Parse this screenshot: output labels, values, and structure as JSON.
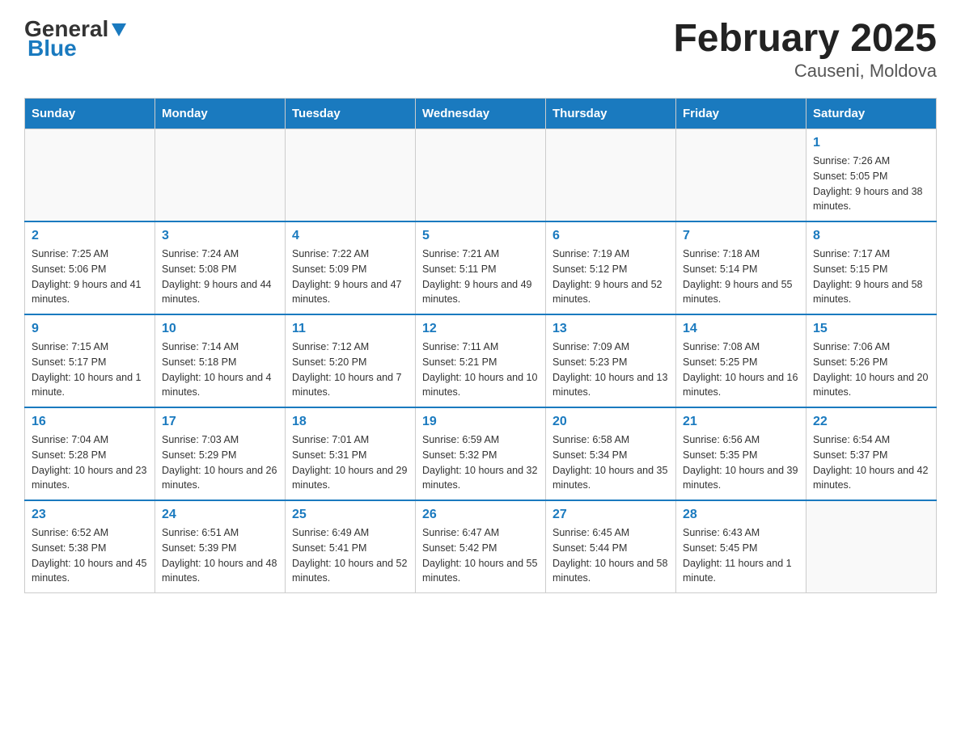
{
  "logo": {
    "general": "General",
    "blue": "Blue"
  },
  "title": "February 2025",
  "location": "Causeni, Moldova",
  "days_of_week": [
    "Sunday",
    "Monday",
    "Tuesday",
    "Wednesday",
    "Thursday",
    "Friday",
    "Saturday"
  ],
  "weeks": [
    [
      {
        "day": "",
        "sunrise": "",
        "sunset": "",
        "daylight": ""
      },
      {
        "day": "",
        "sunrise": "",
        "sunset": "",
        "daylight": ""
      },
      {
        "day": "",
        "sunrise": "",
        "sunset": "",
        "daylight": ""
      },
      {
        "day": "",
        "sunrise": "",
        "sunset": "",
        "daylight": ""
      },
      {
        "day": "",
        "sunrise": "",
        "sunset": "",
        "daylight": ""
      },
      {
        "day": "",
        "sunrise": "",
        "sunset": "",
        "daylight": ""
      },
      {
        "day": "1",
        "sunrise": "Sunrise: 7:26 AM",
        "sunset": "Sunset: 5:05 PM",
        "daylight": "Daylight: 9 hours and 38 minutes."
      }
    ],
    [
      {
        "day": "2",
        "sunrise": "Sunrise: 7:25 AM",
        "sunset": "Sunset: 5:06 PM",
        "daylight": "Daylight: 9 hours and 41 minutes."
      },
      {
        "day": "3",
        "sunrise": "Sunrise: 7:24 AM",
        "sunset": "Sunset: 5:08 PM",
        "daylight": "Daylight: 9 hours and 44 minutes."
      },
      {
        "day": "4",
        "sunrise": "Sunrise: 7:22 AM",
        "sunset": "Sunset: 5:09 PM",
        "daylight": "Daylight: 9 hours and 47 minutes."
      },
      {
        "day": "5",
        "sunrise": "Sunrise: 7:21 AM",
        "sunset": "Sunset: 5:11 PM",
        "daylight": "Daylight: 9 hours and 49 minutes."
      },
      {
        "day": "6",
        "sunrise": "Sunrise: 7:19 AM",
        "sunset": "Sunset: 5:12 PM",
        "daylight": "Daylight: 9 hours and 52 minutes."
      },
      {
        "day": "7",
        "sunrise": "Sunrise: 7:18 AM",
        "sunset": "Sunset: 5:14 PM",
        "daylight": "Daylight: 9 hours and 55 minutes."
      },
      {
        "day": "8",
        "sunrise": "Sunrise: 7:17 AM",
        "sunset": "Sunset: 5:15 PM",
        "daylight": "Daylight: 9 hours and 58 minutes."
      }
    ],
    [
      {
        "day": "9",
        "sunrise": "Sunrise: 7:15 AM",
        "sunset": "Sunset: 5:17 PM",
        "daylight": "Daylight: 10 hours and 1 minute."
      },
      {
        "day": "10",
        "sunrise": "Sunrise: 7:14 AM",
        "sunset": "Sunset: 5:18 PM",
        "daylight": "Daylight: 10 hours and 4 minutes."
      },
      {
        "day": "11",
        "sunrise": "Sunrise: 7:12 AM",
        "sunset": "Sunset: 5:20 PM",
        "daylight": "Daylight: 10 hours and 7 minutes."
      },
      {
        "day": "12",
        "sunrise": "Sunrise: 7:11 AM",
        "sunset": "Sunset: 5:21 PM",
        "daylight": "Daylight: 10 hours and 10 minutes."
      },
      {
        "day": "13",
        "sunrise": "Sunrise: 7:09 AM",
        "sunset": "Sunset: 5:23 PM",
        "daylight": "Daylight: 10 hours and 13 minutes."
      },
      {
        "day": "14",
        "sunrise": "Sunrise: 7:08 AM",
        "sunset": "Sunset: 5:25 PM",
        "daylight": "Daylight: 10 hours and 16 minutes."
      },
      {
        "day": "15",
        "sunrise": "Sunrise: 7:06 AM",
        "sunset": "Sunset: 5:26 PM",
        "daylight": "Daylight: 10 hours and 20 minutes."
      }
    ],
    [
      {
        "day": "16",
        "sunrise": "Sunrise: 7:04 AM",
        "sunset": "Sunset: 5:28 PM",
        "daylight": "Daylight: 10 hours and 23 minutes."
      },
      {
        "day": "17",
        "sunrise": "Sunrise: 7:03 AM",
        "sunset": "Sunset: 5:29 PM",
        "daylight": "Daylight: 10 hours and 26 minutes."
      },
      {
        "day": "18",
        "sunrise": "Sunrise: 7:01 AM",
        "sunset": "Sunset: 5:31 PM",
        "daylight": "Daylight: 10 hours and 29 minutes."
      },
      {
        "day": "19",
        "sunrise": "Sunrise: 6:59 AM",
        "sunset": "Sunset: 5:32 PM",
        "daylight": "Daylight: 10 hours and 32 minutes."
      },
      {
        "day": "20",
        "sunrise": "Sunrise: 6:58 AM",
        "sunset": "Sunset: 5:34 PM",
        "daylight": "Daylight: 10 hours and 35 minutes."
      },
      {
        "day": "21",
        "sunrise": "Sunrise: 6:56 AM",
        "sunset": "Sunset: 5:35 PM",
        "daylight": "Daylight: 10 hours and 39 minutes."
      },
      {
        "day": "22",
        "sunrise": "Sunrise: 6:54 AM",
        "sunset": "Sunset: 5:37 PM",
        "daylight": "Daylight: 10 hours and 42 minutes."
      }
    ],
    [
      {
        "day": "23",
        "sunrise": "Sunrise: 6:52 AM",
        "sunset": "Sunset: 5:38 PM",
        "daylight": "Daylight: 10 hours and 45 minutes."
      },
      {
        "day": "24",
        "sunrise": "Sunrise: 6:51 AM",
        "sunset": "Sunset: 5:39 PM",
        "daylight": "Daylight: 10 hours and 48 minutes."
      },
      {
        "day": "25",
        "sunrise": "Sunrise: 6:49 AM",
        "sunset": "Sunset: 5:41 PM",
        "daylight": "Daylight: 10 hours and 52 minutes."
      },
      {
        "day": "26",
        "sunrise": "Sunrise: 6:47 AM",
        "sunset": "Sunset: 5:42 PM",
        "daylight": "Daylight: 10 hours and 55 minutes."
      },
      {
        "day": "27",
        "sunrise": "Sunrise: 6:45 AM",
        "sunset": "Sunset: 5:44 PM",
        "daylight": "Daylight: 10 hours and 58 minutes."
      },
      {
        "day": "28",
        "sunrise": "Sunrise: 6:43 AM",
        "sunset": "Sunset: 5:45 PM",
        "daylight": "Daylight: 11 hours and 1 minute."
      },
      {
        "day": "",
        "sunrise": "",
        "sunset": "",
        "daylight": ""
      }
    ]
  ]
}
